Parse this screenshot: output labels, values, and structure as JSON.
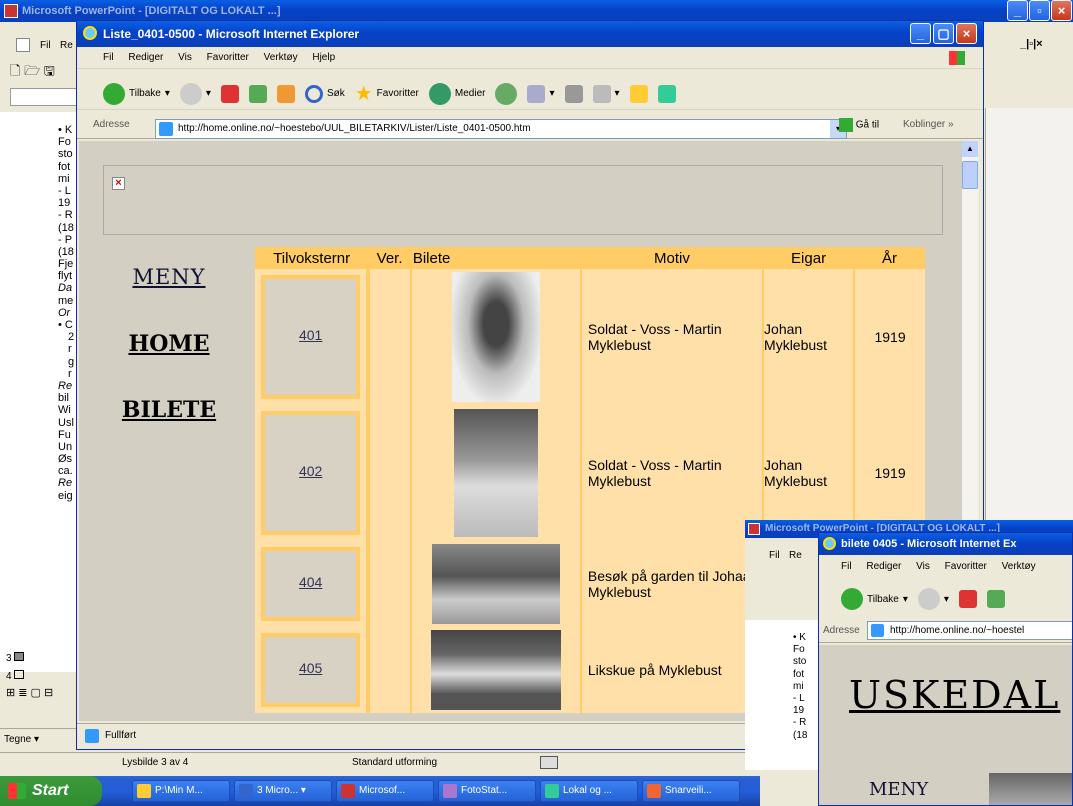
{
  "ppt_bg": {
    "title": "Microsoft PowerPoint - [DIGITALT OG LOKALT ...]",
    "menu_fil": "Fil",
    "menu_rediger": "Re",
    "left_fragments": [
      "• K",
      "Fo",
      "sto",
      "fot",
      "mi",
      "- L",
      "19",
      "- R",
      "(18",
      "- P",
      "(18",
      "Fje",
      "flyt",
      "Da",
      "me",
      "Or",
      "• C",
      "2",
      "r",
      "g",
      "r",
      "Re",
      "bil",
      "Wi",
      "Usl",
      "Fu",
      "Un",
      "Øs",
      "ca.",
      "Re",
      "eig"
    ],
    "slide_nums": [
      "3",
      "4"
    ],
    "draw_label": "Tegne ▾",
    "status_slide": "Lysbilde 3 av 4",
    "status_design": "Standard utforming"
  },
  "ie_main": {
    "title": "Liste_0401-0500 - Microsoft Internet Explorer",
    "menu": [
      "Fil",
      "Rediger",
      "Vis",
      "Favoritter",
      "Verktøy",
      "Hjelp"
    ],
    "toolbar": {
      "back": "Tilbake",
      "search": "Søk",
      "favorites": "Favoritter",
      "media": "Medier"
    },
    "address_label": "Adresse",
    "url": "http://home.online.no/~hoestebo/UUL_BILETARKIV/Lister/Liste_0401-0500.htm",
    "go": "Gå til",
    "links": "Koblinger",
    "status": "Fullført"
  },
  "page": {
    "broken_img": "×",
    "nav": [
      "MENY",
      "HOME",
      "BILETE"
    ],
    "headers": [
      "Tilvoksternr",
      "Ver.",
      "Bilete",
      "Motiv",
      "Eigar",
      "År"
    ],
    "rows": [
      {
        "nr": "401",
        "motiv": "Soldat - Voss - Martin Myklebust",
        "eigar": "Johan Myklebust",
        "ar": "1919"
      },
      {
        "nr": "402",
        "motiv": "Soldat - Voss - Martin Myklebust",
        "eigar": "Johan Myklebust",
        "ar": "1919"
      },
      {
        "nr": "404",
        "motiv": "Besøk på garden til Johaan Myklebust",
        "eigar": "",
        "ar": ""
      },
      {
        "nr": "405",
        "motiv": "Likskue på Myklebust",
        "eigar": "",
        "ar": ""
      }
    ]
  },
  "ppt_small": {
    "title": "Microsoft PowerPoint - [DIGITALT OG LOKALT ...]",
    "menu_fil": "Fil",
    "menu_rediger": "Re",
    "fragments": [
      "• K",
      "Fo",
      "sto",
      "fot",
      "mi",
      "- L",
      "19",
      "- R",
      "(18"
    ]
  },
  "ie_small": {
    "title": "bilete 0405 - Microsoft Internet Ex",
    "menu": [
      "Fil",
      "Rediger",
      "Vis",
      "Favoritter",
      "Verktøy"
    ],
    "back": "Tilbake",
    "address_label": "Adresse",
    "url": "http://home.online.no/~hoestel",
    "heading": "USKEDAL",
    "nav": "MENY"
  },
  "taskbar": {
    "start": "Start",
    "buttons": [
      "P:\\Min M...",
      "3 Micro...",
      "Microsof...",
      "FotoStat...",
      "Lokal og ...",
      "Snarveili..."
    ]
  }
}
